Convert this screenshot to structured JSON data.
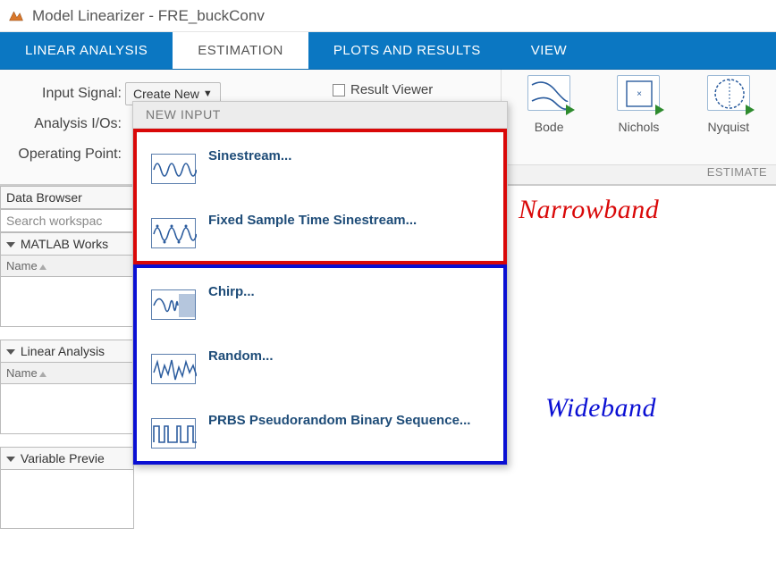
{
  "window": {
    "title": "Model Linearizer - FRE_buckConv"
  },
  "tabs": [
    {
      "label": "LINEAR ANALYSIS"
    },
    {
      "label": "ESTIMATION"
    },
    {
      "label": "PLOTS AND RESULTS"
    },
    {
      "label": "VIEW"
    }
  ],
  "toolstrip": {
    "input_signal_label": "Input Signal:",
    "analysis_ios_label": "Analysis I/Os:",
    "operating_point_label": "Operating Point:",
    "create_new_label": "Create New",
    "result_viewer_label": "Result Viewer",
    "group_label": "ESTIMATE"
  },
  "plot_buttons": [
    {
      "label": "Bode"
    },
    {
      "label": "Nichols"
    },
    {
      "label": "Nyquist"
    }
  ],
  "dropdown": {
    "header": "NEW INPUT",
    "narrowband": [
      {
        "label": "Sinestream..."
      },
      {
        "label": "Fixed Sample Time Sinestream..."
      }
    ],
    "wideband": [
      {
        "label": "Chirp..."
      },
      {
        "label": "Random..."
      },
      {
        "label": "PRBS Pseudorandom Binary Sequence..."
      }
    ]
  },
  "annotations": {
    "narrowband": "Narrowband",
    "wideband": "Wideband"
  },
  "left_panels": {
    "data_browser": "Data Browser",
    "search_placeholder": "Search workspac",
    "matlab_ws": "MATLAB Works",
    "name_col": "Name",
    "linear_analysis": "Linear Analysis",
    "variable_preview": "Variable Previe"
  }
}
